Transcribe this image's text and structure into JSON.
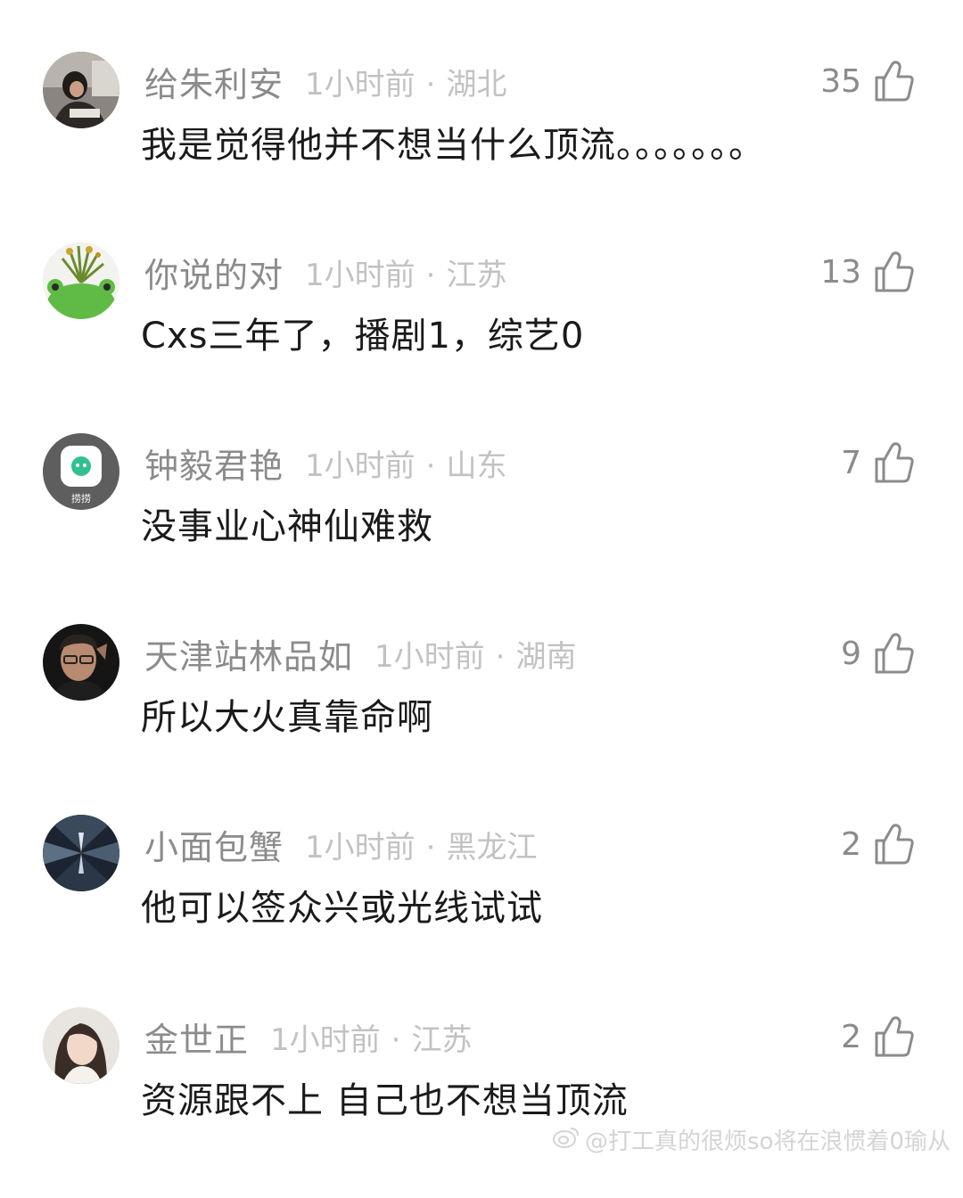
{
  "comments": [
    {
      "username": "给朱利安",
      "time": "1小时前",
      "location": "湖北",
      "likes": "35",
      "content": "我是觉得他并不想当什么顶流。。。。。。。",
      "avatar": "avatar-woman-reading"
    },
    {
      "username": "你说的对",
      "time": "1小时前",
      "location": "江苏",
      "likes": "13",
      "content": "Cxs三年了，播剧1，综艺0",
      "avatar": "avatar-plant-frog"
    },
    {
      "username": "钟毅君艳",
      "time": "1小时前",
      "location": "山东",
      "likes": "7",
      "content": "没事业心神仙难救",
      "avatar": "avatar-app-logo",
      "avatar_text": "捞捞"
    },
    {
      "username": "天津站林品如",
      "time": "1小时前",
      "location": "湖南",
      "likes": "9",
      "content": "所以大火真靠命啊",
      "avatar": "avatar-man-glasses"
    },
    {
      "username": "小面包蟹",
      "time": "1小时前",
      "location": "黑龙江",
      "likes": "2",
      "content": "他可以签众兴或光线试试",
      "avatar": "avatar-dark-abstract"
    },
    {
      "username": "金世正",
      "time": "1小时前",
      "location": "江苏",
      "likes": "2",
      "content": "资源跟不上 自己也不想当顶流",
      "avatar": "avatar-woman-portrait"
    }
  ],
  "separator": "·",
  "watermark": "@打工真的很烦so将在浪惯着0瑜从",
  "icons": {
    "like": "thumbs-up-icon",
    "weibo": "weibo-icon"
  },
  "colors": {
    "username": "#8b8b8b",
    "meta": "#c2c2c2",
    "content": "#1a1a1a",
    "likes": "#8b8b8b"
  }
}
